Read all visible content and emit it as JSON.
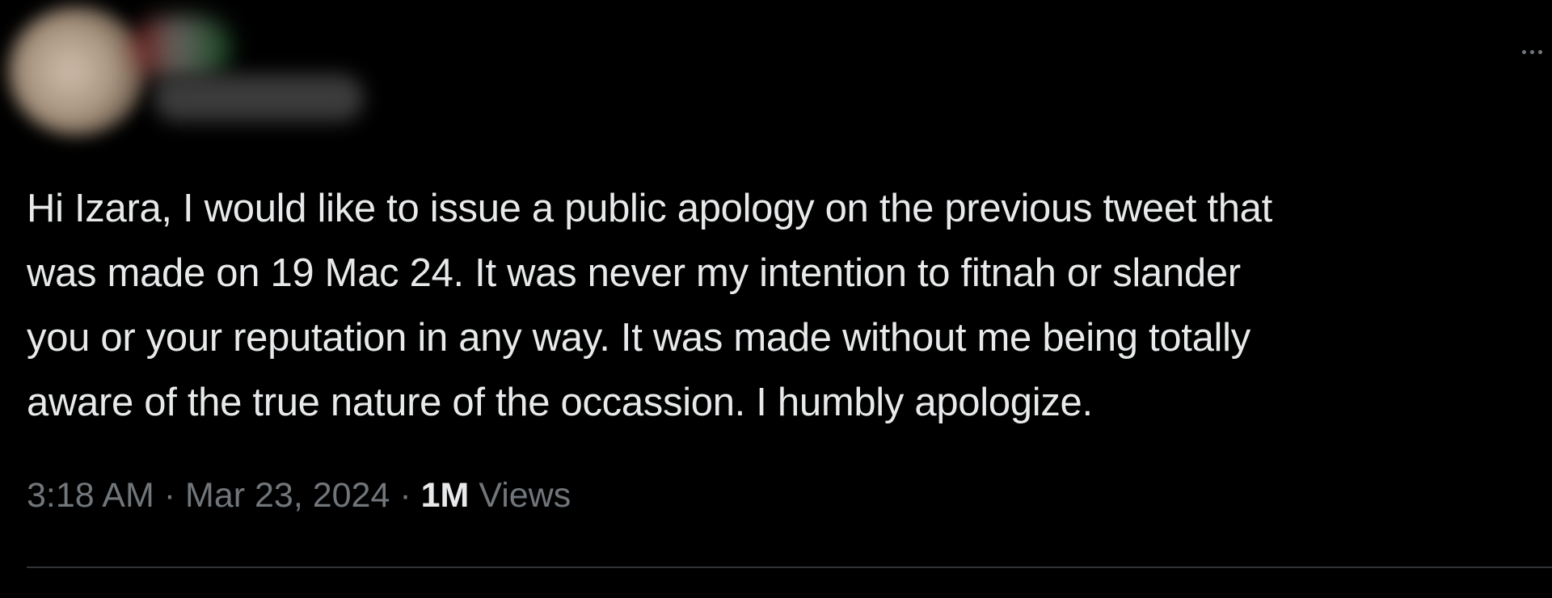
{
  "tweet": {
    "text_lines": [
      "Hi Izara, I would like to issue a public apology on the previous tweet that",
      "was made on 19 Mac 24. It was never my intention to fitnah or slander",
      "you or your reputation in any way. It was made without me being totally",
      "aware of the true nature of the occassion. I humbly apologize."
    ],
    "time": "3:18 AM",
    "separator": "·",
    "date": "Mar 23, 2024",
    "views_count": "1M",
    "views_label": "Views"
  },
  "icons": {
    "more": "more-horizontal-icon"
  },
  "colors": {
    "background": "#000000",
    "text": "#e7e9ea",
    "secondary_text": "#71767b",
    "divider": "#2f3336"
  }
}
